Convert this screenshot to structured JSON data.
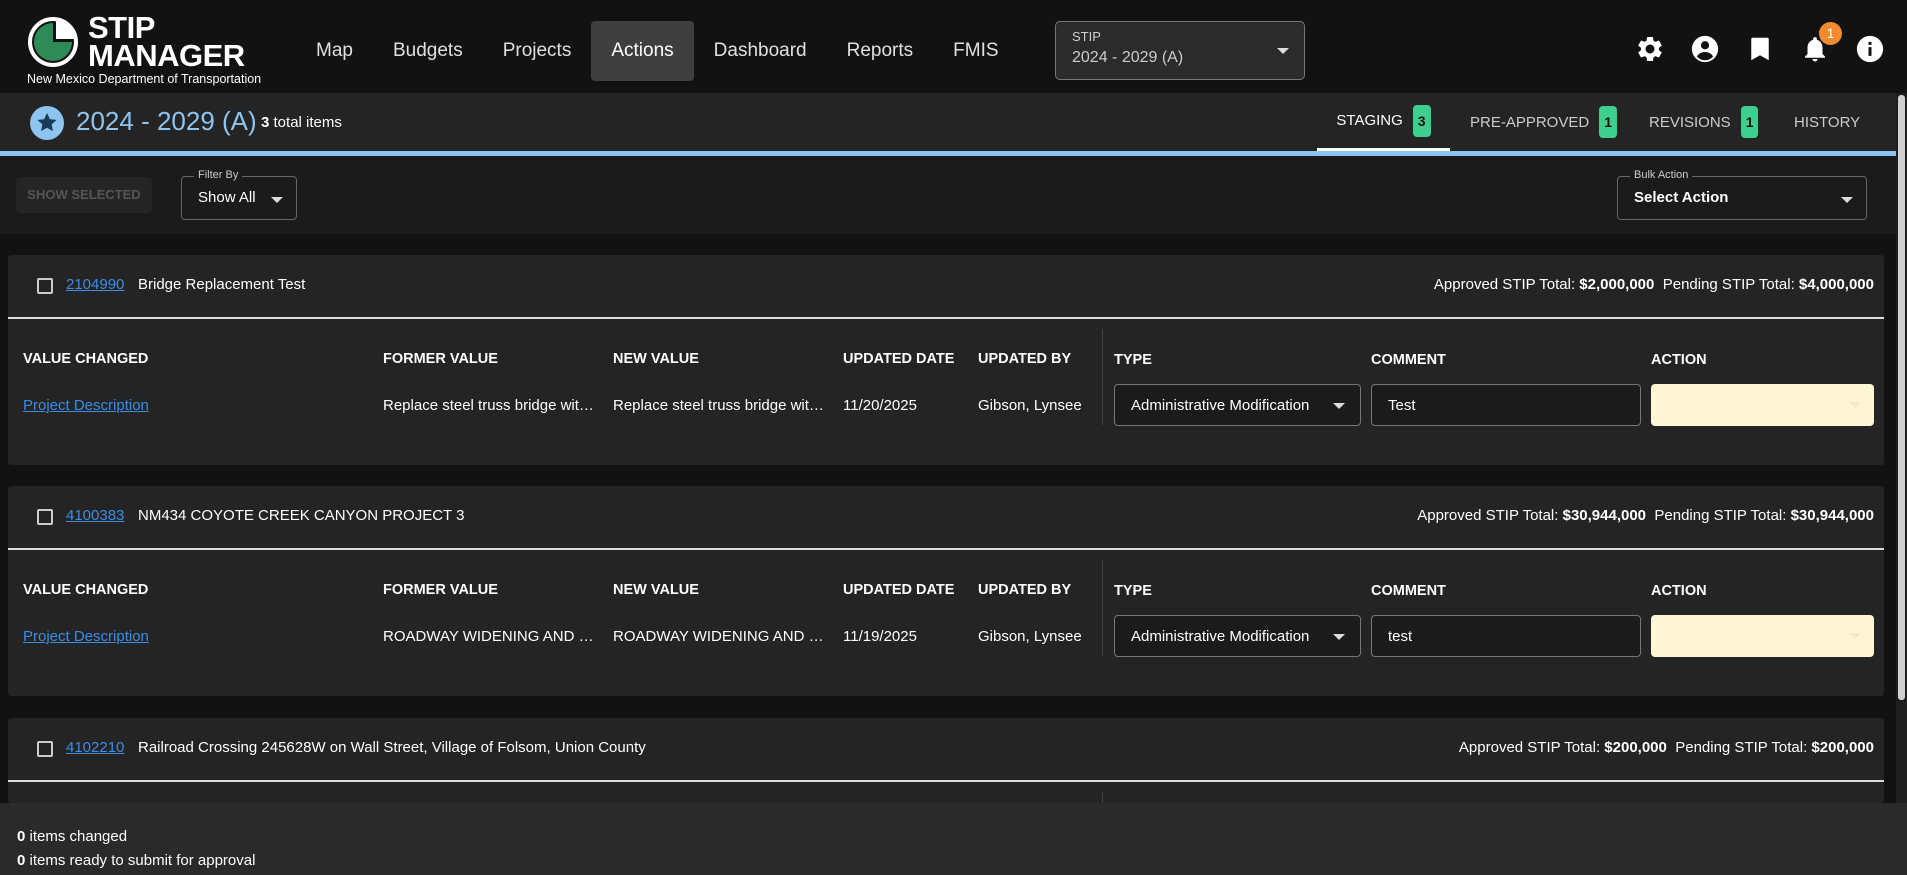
{
  "app": {
    "logo_title_line1": "STIP",
    "logo_title_line2": "MANAGER",
    "logo_subtitle": "New Mexico Department of Transportation"
  },
  "nav": {
    "items": [
      "Map",
      "Budgets",
      "Projects",
      "Actions",
      "Dashboard",
      "Reports",
      "FMIS"
    ],
    "active": "Actions"
  },
  "stip_select": {
    "label": "STIP",
    "value": "2024 - 2029 (A)"
  },
  "top_icons": [
    "gear-icon",
    "account-circle-icon",
    "bookmark-icon",
    "bell-icon",
    "info-icon"
  ],
  "notifications": {
    "count": "1"
  },
  "subheader": {
    "title": "2024 - 2029 (A)",
    "total_count": "3",
    "total_suffix": " total items"
  },
  "tabs": [
    {
      "label": "STAGING",
      "badge": "3",
      "active": true
    },
    {
      "label": "PRE-APPROVED",
      "badge": "1",
      "active": false
    },
    {
      "label": "REVISIONS",
      "badge": "1",
      "active": false
    },
    {
      "label": "HISTORY",
      "badge": "",
      "active": false
    }
  ],
  "toolbar": {
    "show_selected_label": "SHOW SELECTED",
    "filter_label": "Filter By",
    "filter_value": "Show All",
    "bulk_label": "Bulk Action",
    "bulk_value": "Select Action"
  },
  "columns": {
    "value_changed": "VALUE CHANGED",
    "former_value": "FORMER VALUE",
    "new_value": "NEW VALUE",
    "updated_date": "UPDATED DATE",
    "updated_by": "UPDATED BY",
    "type": "TYPE",
    "comment": "COMMENT",
    "action": "ACTION"
  },
  "totals_labels": {
    "approved": "Approved STIP Total: ",
    "pending": "Pending STIP Total: "
  },
  "cards": [
    {
      "id": "2104990",
      "name": "Bridge Replacement Test",
      "approved_total": "$2,000,000",
      "pending_total": "$4,000,000",
      "row": {
        "value_changed": "Project Description",
        "former_value": "Replace steel truss bridge wit…",
        "new_value": "Replace steel truss bridge wit…",
        "updated_date": "11/20/2025",
        "updated_by": "Gibson, Lynsee",
        "type": "Administrative Modification",
        "comment": "Test",
        "action": ""
      }
    },
    {
      "id": "4100383",
      "name": "NM434 COYOTE CREEK CANYON PROJECT 3",
      "approved_total": "$30,944,000",
      "pending_total": "$30,944,000",
      "row": {
        "value_changed": "Project Description",
        "former_value": "ROADWAY WIDENING AND RE…",
        "new_value": "ROADWAY WIDENING AND RE…",
        "updated_date": "11/19/2025",
        "updated_by": "Gibson, Lynsee",
        "type": "Administrative Modification",
        "comment": "test",
        "action": ""
      }
    },
    {
      "id": "4102210",
      "name": "Railroad Crossing 245628W on Wall Street, Village of Folsom, Union County",
      "approved_total": "$200,000",
      "pending_total": "$200,000"
    }
  ],
  "footer": {
    "changed_count": "0",
    "changed_suffix": " items changed",
    "ready_count": "0",
    "ready_suffix": " items ready to submit for approval"
  },
  "colors": {
    "accent_blue": "#8ec5f0",
    "link_blue": "#3a8ee6",
    "badge_green": "#3ecf8e",
    "badge_orange": "#f28b30",
    "action_field": "#fff6d6"
  }
}
